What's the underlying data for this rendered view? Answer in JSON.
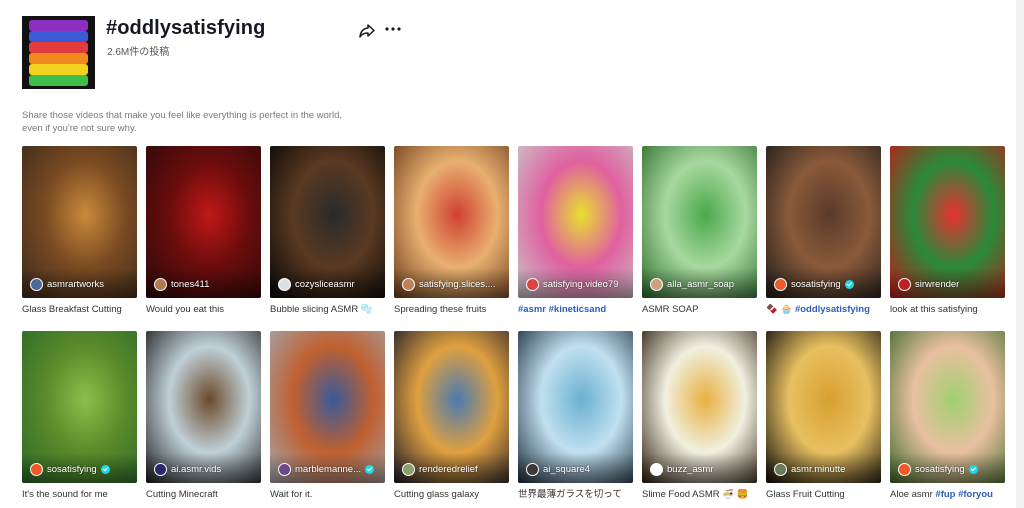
{
  "header": {
    "title": "#oddlysatisfying",
    "post_count": "2.6M件の投稿",
    "description": "Share those videos that make you feel like everything is perfect in the world, even if you're not sure why.",
    "cover_colors": [
      "#8b2fbf",
      "#3b5bd6",
      "#e23b3b",
      "#f08a1c",
      "#f2d21e",
      "#3fbf4a"
    ]
  },
  "videos": [
    {
      "author": "asmrartworks",
      "caption": "Glass Breakfast Cutting",
      "verified": false,
      "thumb_colors": [
        "#3a2a1c",
        "#c98a3a",
        "#7a4a22"
      ],
      "avatar_color": "#4a6a9a"
    },
    {
      "author": "tones411",
      "caption": "Would you eat this",
      "verified": false,
      "thumb_colors": [
        "#2a0a0a",
        "#c01818",
        "#6a0c0c"
      ],
      "avatar_color": "#b07a4a"
    },
    {
      "author": "cozysliceasmr",
      "caption": "Bubble slicing ASMR 🫧",
      "verified": false,
      "thumb_colors": [
        "#050505",
        "#2a2a2a",
        "#5a3a22"
      ],
      "avatar_color": "#e0e0e0"
    },
    {
      "author": "satisfying.slices....",
      "caption": "Spreading these fruits",
      "verified": false,
      "thumb_colors": [
        "#6a3a1a",
        "#d04030",
        "#e8b070"
      ],
      "avatar_color": "#c0805a"
    },
    {
      "author": "satisfying.video79",
      "caption": "#asmr #kineticsand",
      "verified": false,
      "tags": true,
      "thumb_colors": [
        "#c8c8c8",
        "#e8e030",
        "#e060a0"
      ],
      "avatar_color": "#e04040"
    },
    {
      "author": "alla_asmr_soap",
      "caption": "ASMR SOAP",
      "verified": false,
      "thumb_colors": [
        "#2a6a2a",
        "#4aa84a",
        "#a8d8a0"
      ],
      "avatar_color": "#d0a080"
    },
    {
      "author": "sosatisfying",
      "caption": "🍫 🧁 #oddlysatisfying",
      "verified": true,
      "tags": true,
      "thumb_colors": [
        "#1a1a1a",
        "#5a3a2a",
        "#8a5a3a"
      ],
      "avatar_color": "#f05a28"
    },
    {
      "author": "sirwrender",
      "caption": "look at this satisfying",
      "verified": false,
      "thumb_colors": [
        "#c01818",
        "#e83030",
        "#2a8a3a"
      ],
      "avatar_color": "#c02020"
    },
    {
      "author": "sosatisfying",
      "caption": "It's the sound for me",
      "verified": true,
      "thumb_colors": [
        "#2a6a2a",
        "#8ac04a",
        "#5a8a2a"
      ],
      "avatar_color": "#f05a28"
    },
    {
      "author": "ai.asmr.vids",
      "caption": "Cutting Minecraft",
      "verified": false,
      "thumb_colors": [
        "#1a1a1a",
        "#6a4a2a",
        "#c0d0d8"
      ],
      "avatar_color": "#2a2a6a"
    },
    {
      "author": "marblemanne...",
      "caption": "Wait for it.",
      "verified": true,
      "thumb_colors": [
        "#a0a8b0",
        "#3a5a9a",
        "#c06030"
      ],
      "avatar_color": "#6a4a8a"
    },
    {
      "author": "renderedrelief",
      "caption": "Cutting glass galaxy",
      "verified": false,
      "thumb_colors": [
        "#1a1a2a",
        "#4a7ab0",
        "#e0a040"
      ],
      "avatar_color": "#8aa070"
    },
    {
      "author": "ai_square4",
      "caption": "世界最薄ガラスを切って",
      "verified": false,
      "thumb_colors": [
        "#1a2a3a",
        "#6ab0d0",
        "#c0e0f0"
      ],
      "avatar_color": "#3a3a3a"
    },
    {
      "author": "buzz_asmr",
      "caption": "Slime Food ASMR 🍜 🍔",
      "verified": false,
      "thumb_colors": [
        "#2a1a0a",
        "#e8b040",
        "#f0f0e0"
      ],
      "avatar_color": "#ffffff"
    },
    {
      "author": "asmr.minutte",
      "caption": "Glass Fruit Cutting",
      "verified": false,
      "thumb_colors": [
        "#0a0a0a",
        "#d8a030",
        "#e8c060"
      ],
      "avatar_color": "#6a7a5a"
    },
    {
      "author": "sosatisfying",
      "caption": "Aloe asmr #fup #foryou",
      "verified": true,
      "thumb_colors": [
        "#3a6a2a",
        "#a0d070",
        "#e8c0a0"
      ],
      "avatar_color": "#f05a28"
    }
  ]
}
